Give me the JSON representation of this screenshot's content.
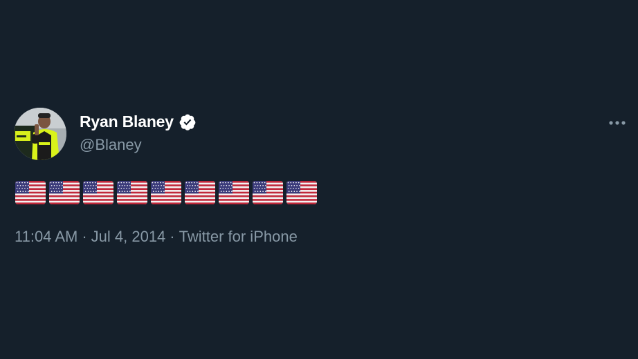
{
  "user": {
    "display_name": "Ryan Blaney",
    "handle": "@Blaney",
    "verified": true,
    "avatar_icon": "avatar-photo"
  },
  "tweet": {
    "text_emoji": "🇺🇸🇺🇸🇺🇸🇺🇸🇺🇸🇺🇸🇺🇸🇺🇸🇺🇸",
    "emoji_icon": "us-flag-icon",
    "emoji_count": 9
  },
  "meta": {
    "time": "11:04 AM",
    "separator": "·",
    "date": "Jul 4, 2014",
    "source": "Twitter for iPhone"
  },
  "icons": {
    "verified": "verified-badge-icon",
    "more": "more-options-icon"
  },
  "colors": {
    "background": "#15202b",
    "text_primary": "#ffffff",
    "text_secondary": "#8899a6"
  }
}
